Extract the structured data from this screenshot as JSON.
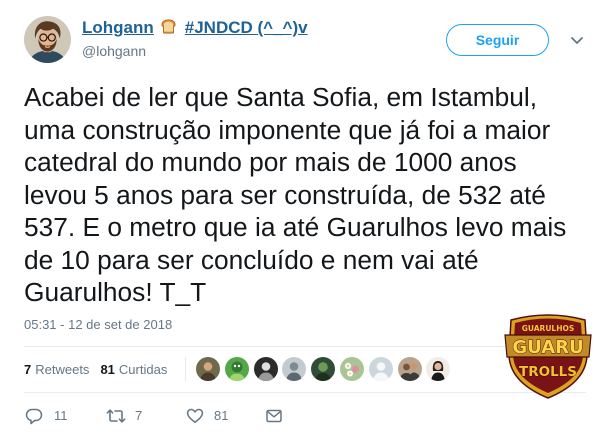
{
  "theme": {
    "accent": "#1da1f2",
    "text_primary": "#14171a",
    "text_secondary": "#657786",
    "name_link": "#1f6396",
    "border": "#e6ecf0"
  },
  "tweet": {
    "author": {
      "avatar_icon": "avatar",
      "display_name": "Lohgann",
      "name_emoji_icon": "bread-icon",
      "name_suffix": "#JNDCD (^_^)v",
      "handle": "@lohgann"
    },
    "follow_label": "Seguir",
    "menu_icon": "chevron-down-icon",
    "text_lines": [
      "Acabei de ler que Santa Sofia, em Istambul,",
      "uma construção imponente que já foi a maior",
      "catedral do mundo por mais de 1000 anos",
      "levou 5 anos para ser construída, de 532 até",
      "537. E o metro que ia até Guarulhos levo mais",
      "de 10 para ser concluído e nem vai até",
      "Guarulhos! T_T"
    ],
    "timestamp": "05:31 - 12 de set de 2018",
    "stats": {
      "retweets_count": "7",
      "retweets_label": "Retweets",
      "likes_count": "81",
      "likes_label": "Curtidas"
    },
    "actions": [
      {
        "icon": "reply-icon",
        "count": "11"
      },
      {
        "icon": "retweet-icon",
        "count": "7"
      },
      {
        "icon": "heart-icon",
        "count": "81"
      },
      {
        "icon": "envelope-icon"
      }
    ]
  },
  "watermark": {
    "top_text": "GUARULHOS",
    "main_text": "GUARU",
    "bottom_text": "TROLLS"
  }
}
